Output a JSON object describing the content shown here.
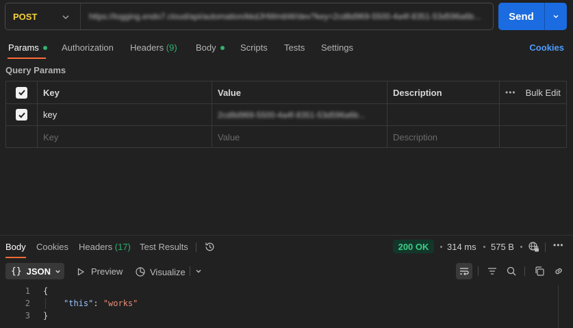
{
  "request": {
    "method": "POST",
    "url": "https://logging.endo7.cloud/api/automation/kkdJHWmbW/dev?key=2cd8d969-5500-4a4f-8351-53d596a6b...",
    "send_label": "Send"
  },
  "request_tabs": {
    "params": "Params",
    "authorization": "Authorization",
    "headers": "Headers",
    "headers_count": "(9)",
    "body": "Body",
    "scripts": "Scripts",
    "tests": "Tests",
    "settings": "Settings",
    "cookies": "Cookies"
  },
  "query_params": {
    "section_label": "Query Params",
    "headers": {
      "key": "Key",
      "value": "Value",
      "description": "Description",
      "bulk_edit": "Bulk Edit"
    },
    "rows": [
      {
        "checked": true,
        "key": "key",
        "value": "2cd8d969-5500-4a4f-8351-53d596a6b...",
        "description": ""
      }
    ],
    "placeholders": {
      "key": "Key",
      "value": "Value",
      "description": "Description"
    }
  },
  "response_tabs": {
    "body": "Body",
    "cookies": "Cookies",
    "headers": "Headers",
    "headers_count": "(17)",
    "test_results": "Test Results"
  },
  "response_meta": {
    "status": "200 OK",
    "time": "314 ms",
    "size": "575 B",
    "status_color": "#3ccf86"
  },
  "response_toolbar": {
    "format": "JSON",
    "preview": "Preview",
    "visualize": "Visualize"
  },
  "response_body": {
    "line_numbers": [
      "1",
      "2",
      "3"
    ],
    "open_brace": "{",
    "key": "\"this\"",
    "colon": ": ",
    "value": "\"works\"",
    "close_brace": "}"
  },
  "colors": {
    "accent": "#1a6ce0",
    "tab_underline": "#ff6c37",
    "method": "#f4d13d",
    "link": "#4f9cff"
  },
  "icons": [
    "chevron-down-icon",
    "check-icon",
    "more-horizontal-icon",
    "history-icon",
    "globe-lock-icon",
    "more-icon",
    "play-icon",
    "visualize-icon",
    "wrap-icon",
    "filter-icon",
    "search-icon",
    "copy-icon",
    "link-icon"
  ]
}
